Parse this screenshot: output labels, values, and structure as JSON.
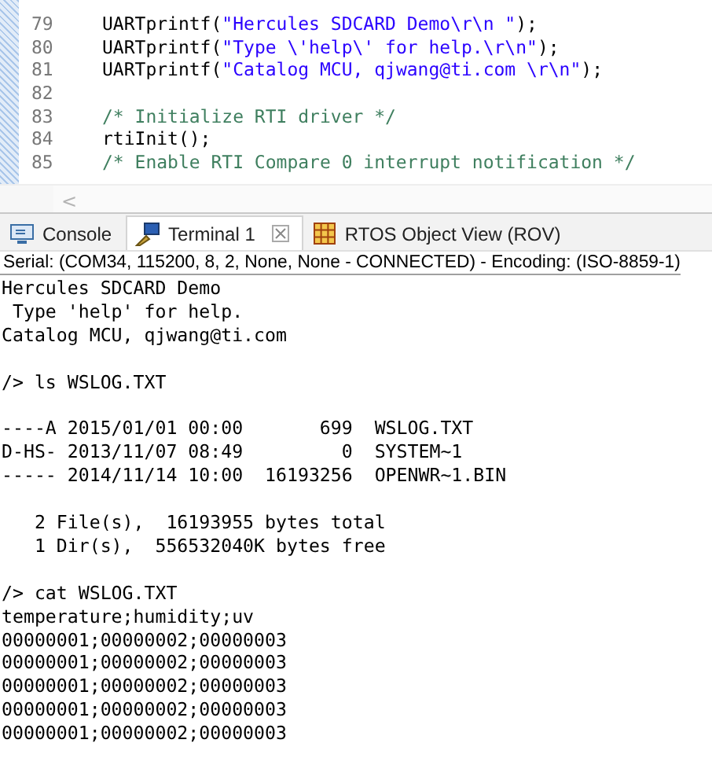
{
  "editor": {
    "lines": [
      {
        "number": "79",
        "segments": [
          {
            "kind": "code",
            "text": "UARTprintf("
          },
          {
            "kind": "string",
            "text": "\"Hercules SDCARD Demo\\r\\n \""
          },
          {
            "kind": "code",
            "text": ");"
          }
        ]
      },
      {
        "number": "80",
        "segments": [
          {
            "kind": "code",
            "text": "UARTprintf("
          },
          {
            "kind": "string",
            "text": "\"Type \\'help\\' for help.\\r\\n\""
          },
          {
            "kind": "code",
            "text": ");"
          }
        ]
      },
      {
        "number": "81",
        "segments": [
          {
            "kind": "code",
            "text": "UARTprintf("
          },
          {
            "kind": "string",
            "text": "\"Catalog MCU, qjwang@ti.com \\r\\n\""
          },
          {
            "kind": "code",
            "text": ");"
          }
        ]
      },
      {
        "number": "82"
      },
      {
        "number": "83",
        "segments": [
          {
            "kind": "comment",
            "text": "/* Initialize RTI driver */"
          }
        ]
      },
      {
        "number": "84",
        "segments": [
          {
            "kind": "code",
            "text": "rtiInit();"
          }
        ]
      },
      {
        "number": "85",
        "segments": [
          {
            "kind": "comment",
            "text": "/* Enable RTI Compare 0 interrupt notification */"
          }
        ]
      }
    ],
    "scroll_left": "<"
  },
  "tabs": [
    {
      "label": "Console",
      "selected": false,
      "closable": false
    },
    {
      "label": "Terminal 1",
      "selected": true,
      "closable": true
    },
    {
      "label": "RTOS Object View (ROV)",
      "selected": false,
      "closable": false
    }
  ],
  "terminal": {
    "status": "Serial: (COM34, 115200, 8, 2, None, None - CONNECTED) - Encoding: (ISO-8859-1)",
    "blocks": [
      [
        "Hercules SDCARD Demo",
        " Type 'help' for help.",
        "Catalog MCU, qjwang@ti.com"
      ],
      [
        "/> ls WSLOG.TXT"
      ],
      [
        "----A 2015/01/01 00:00       699  WSLOG.TXT",
        "D-HS- 2013/11/07 08:49         0  SYSTEM~1",
        "----- 2014/11/14 10:00  16193256  OPENWR~1.BIN"
      ],
      [
        "   2 File(s),  16193955 bytes total",
        "   1 Dir(s),  556532040K bytes free"
      ],
      [
        "/> cat WSLOG.TXT",
        "temperature;humidity;uv",
        "00000001;00000002;00000003",
        "00000001;00000002;00000003",
        "00000001;00000002;00000003",
        "00000001;00000002;00000003",
        "00000001;00000002;00000003"
      ]
    ]
  }
}
